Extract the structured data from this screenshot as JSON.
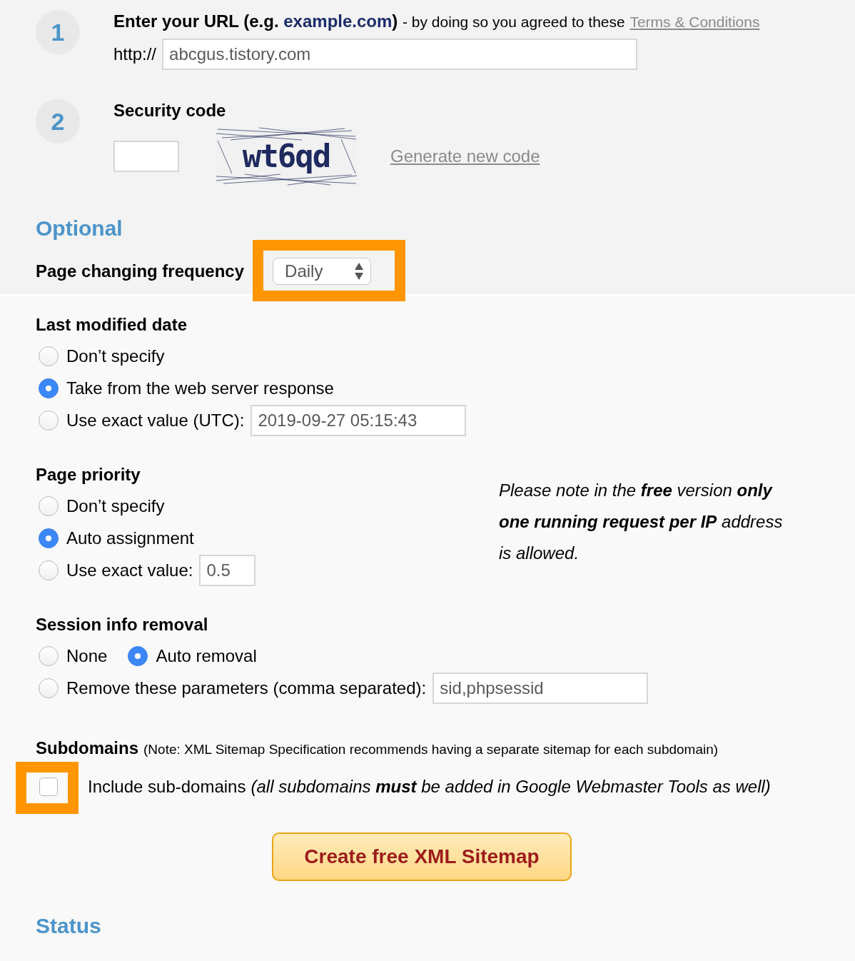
{
  "url_step": {
    "number": "1",
    "title": "Enter your URL (e.g.",
    "example": "example.com",
    "title_end": ")",
    "agreement": "- by doing so you agreed to these",
    "terms_link": "Terms & Conditions",
    "prefix": "http://",
    "value": "abcgus.tistory.com"
  },
  "security_step": {
    "number": "2",
    "title": "Security code",
    "captcha": "wt6qd",
    "regenerate_link": "Generate new code"
  },
  "optional": {
    "heading": "Optional",
    "frequency": {
      "label": "Page changing frequency",
      "value": "Daily",
      "highlighted": true
    }
  },
  "last_modified": {
    "heading": "Last modified date",
    "rows": [
      {
        "options": [
          {
            "label": "Don’t specify",
            "selected": false
          }
        ]
      },
      {
        "options": [
          {
            "label": "Take from the web server response",
            "selected": true
          }
        ]
      },
      {
        "options": [
          {
            "label": "Use exact value (UTC):",
            "selected": false,
            "value": "2019-09-27 05:15:43"
          }
        ]
      }
    ]
  },
  "priority": {
    "heading": "Page priority",
    "rows": [
      {
        "options": [
          {
            "label": "Don’t specify",
            "selected": false
          }
        ]
      },
      {
        "options": [
          {
            "label": "Auto assignment",
            "selected": true
          }
        ]
      },
      {
        "options": [
          {
            "label": "Use exact value:",
            "selected": false,
            "value": "0.5"
          }
        ]
      }
    ],
    "note": "Please note in the **free** version **only one running request per IP** address is allowed."
  },
  "session": {
    "heading": "Session info removal",
    "rows": [
      {
        "options": [
          {
            "label": "None",
            "selected": false
          },
          {
            "label": "Auto removal",
            "selected": true
          }
        ]
      },
      {
        "options": [
          {
            "label": "Remove these parameters (comma separated):",
            "selected": false,
            "value": "sid,phpsessid"
          }
        ]
      }
    ]
  },
  "subdomains": {
    "heading": "Subdomains",
    "note": "(Note: XML Sitemap Specification recommends having a separate sitemap for each subdomain)",
    "checkbox": {
      "label": "Include sub-domains",
      "hint": "(all subdomains **must** be added in Google Webmaster Tools as well)",
      "checked": false,
      "highlighted": true
    }
  },
  "submit_button": "Create free XML Sitemap",
  "status": {
    "heading": "Status"
  }
}
